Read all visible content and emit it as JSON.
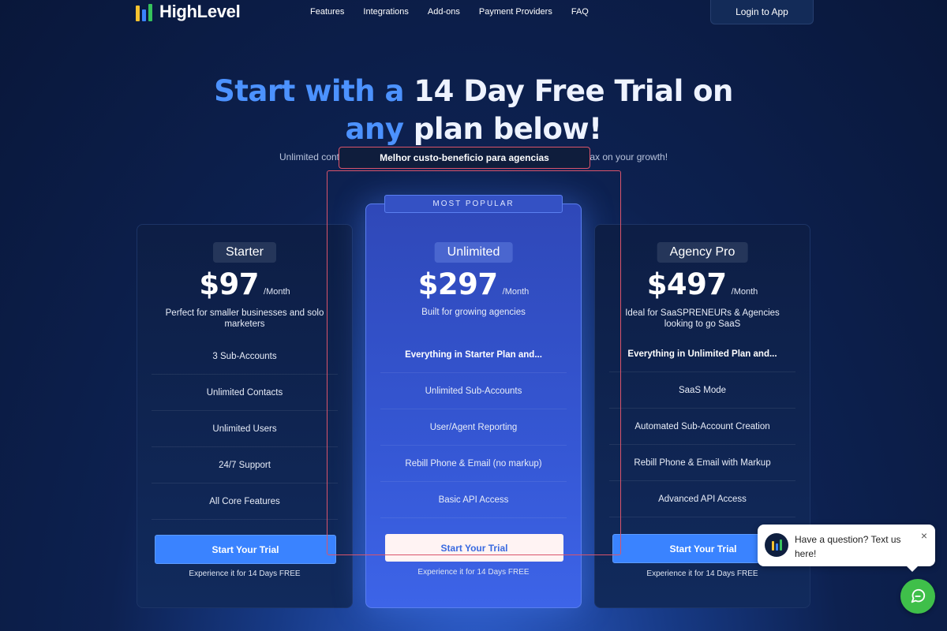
{
  "brand": {
    "name": "HighLevel"
  },
  "nav": {
    "links": [
      "Features",
      "Integrations",
      "Add-ons",
      "Payment Providers",
      "FAQ"
    ],
    "login": "Login to App"
  },
  "hero": {
    "line1_a": "Start with",
    "line1_b": "a",
    "line1_c": "14 Day Free Trial on",
    "line2_a": "any",
    "line2_b": "plan below!",
    "sub_left": "Unlimited contacts,",
    "sub_right": "ut a tax on your growth!"
  },
  "tooltip": "Melhor custo-beneficio para agencias",
  "popular_badge": "MOST POPULAR",
  "plans": [
    {
      "name": "Starter",
      "price": "$97",
      "period": "/Month",
      "description": "Perfect for smaller businesses and solo marketers",
      "features": [
        "3 Sub-Accounts",
        "Unlimited Contacts",
        "Unlimited Users",
        "24/7 Support",
        "All Core Features"
      ],
      "cta": "Start Your Trial",
      "note": "Experience it for 14 Days FREE"
    },
    {
      "name": "Unlimited",
      "price": "$297",
      "period": "/Month",
      "description": "Built for growing agencies",
      "features": [
        "Everything in Starter Plan and...",
        "Unlimited Sub-Accounts",
        "User/Agent Reporting",
        "Rebill Phone & Email (no markup)",
        "Basic API Access"
      ],
      "cta": "Start Your Trial",
      "note": "Experience it for 14 Days FREE"
    },
    {
      "name": "Agency Pro",
      "price": "$497",
      "period": "/Month",
      "description": "Ideal for SaaSPRENEURs & Agencies looking to go SaaS",
      "features": [
        "Everything in Unlimited Plan and...",
        "SaaS Mode",
        "Automated Sub-Account Creation",
        "Rebill Phone & Email with Markup",
        "Advanced API Access"
      ],
      "cta": "Start Your Trial",
      "note": "Experience it for 14 Days FREE"
    }
  ],
  "chat": {
    "message": "Have a question? Text us here!",
    "close": "×"
  },
  "colors": {
    "accent_blue": "#4c92ff",
    "cta_blue": "#3a83ff",
    "highlight_red": "#d9546b",
    "chat_green": "#3fbf4a"
  }
}
